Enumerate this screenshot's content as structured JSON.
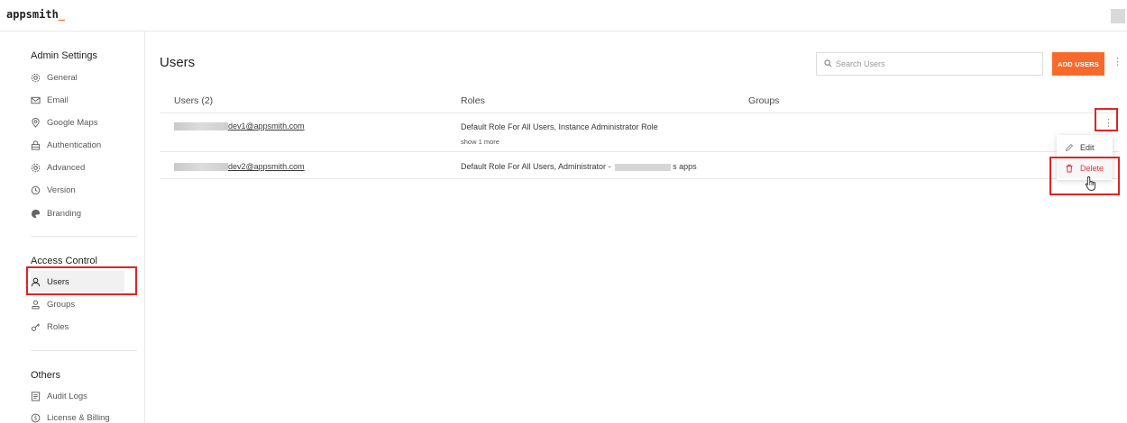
{
  "app": {
    "logo_text": "appsmith",
    "logo_cursor": "_"
  },
  "sidebar": {
    "sections": [
      {
        "title": "Admin Settings",
        "items": [
          {
            "label": "General",
            "icon": "gear-icon"
          },
          {
            "label": "Email",
            "icon": "mail-icon"
          },
          {
            "label": "Google Maps",
            "icon": "map-pin-icon"
          },
          {
            "label": "Authentication",
            "icon": "lock-icon"
          },
          {
            "label": "Advanced",
            "icon": "gear-icon"
          },
          {
            "label": "Version",
            "icon": "clock-icon"
          },
          {
            "label": "Branding",
            "icon": "palette-icon"
          }
        ]
      },
      {
        "title": "Access Control",
        "items": [
          {
            "label": "Users",
            "icon": "user-icon",
            "active": true
          },
          {
            "label": "Groups",
            "icon": "group-icon"
          },
          {
            "label": "Roles",
            "icon": "key-icon"
          }
        ]
      },
      {
        "title": "Others",
        "items": [
          {
            "label": "Audit Logs",
            "icon": "log-icon"
          },
          {
            "label": "License & Billing",
            "icon": "billing-icon"
          }
        ]
      }
    ]
  },
  "main": {
    "title": "Users",
    "search_placeholder": "Search Users",
    "add_button": "ADD USERS",
    "table": {
      "columns": [
        "Users (2)",
        "Roles",
        "Groups"
      ],
      "rows": [
        {
          "email": "dev1@appsmith.com",
          "roles": "Default Role For All Users, Instance Administrator Role",
          "show_more": "show 1 more"
        },
        {
          "email": "dev2@appsmith.com",
          "roles_prefix": "Default Role For All Users, Administrator - ",
          "roles_suffix": "s apps"
        }
      ]
    },
    "row_menu": {
      "edit": "Edit",
      "delete": "Delete"
    }
  },
  "colors": {
    "accent": "#f86a2b",
    "danger": "#e5343b",
    "highlight": "#e02424"
  }
}
